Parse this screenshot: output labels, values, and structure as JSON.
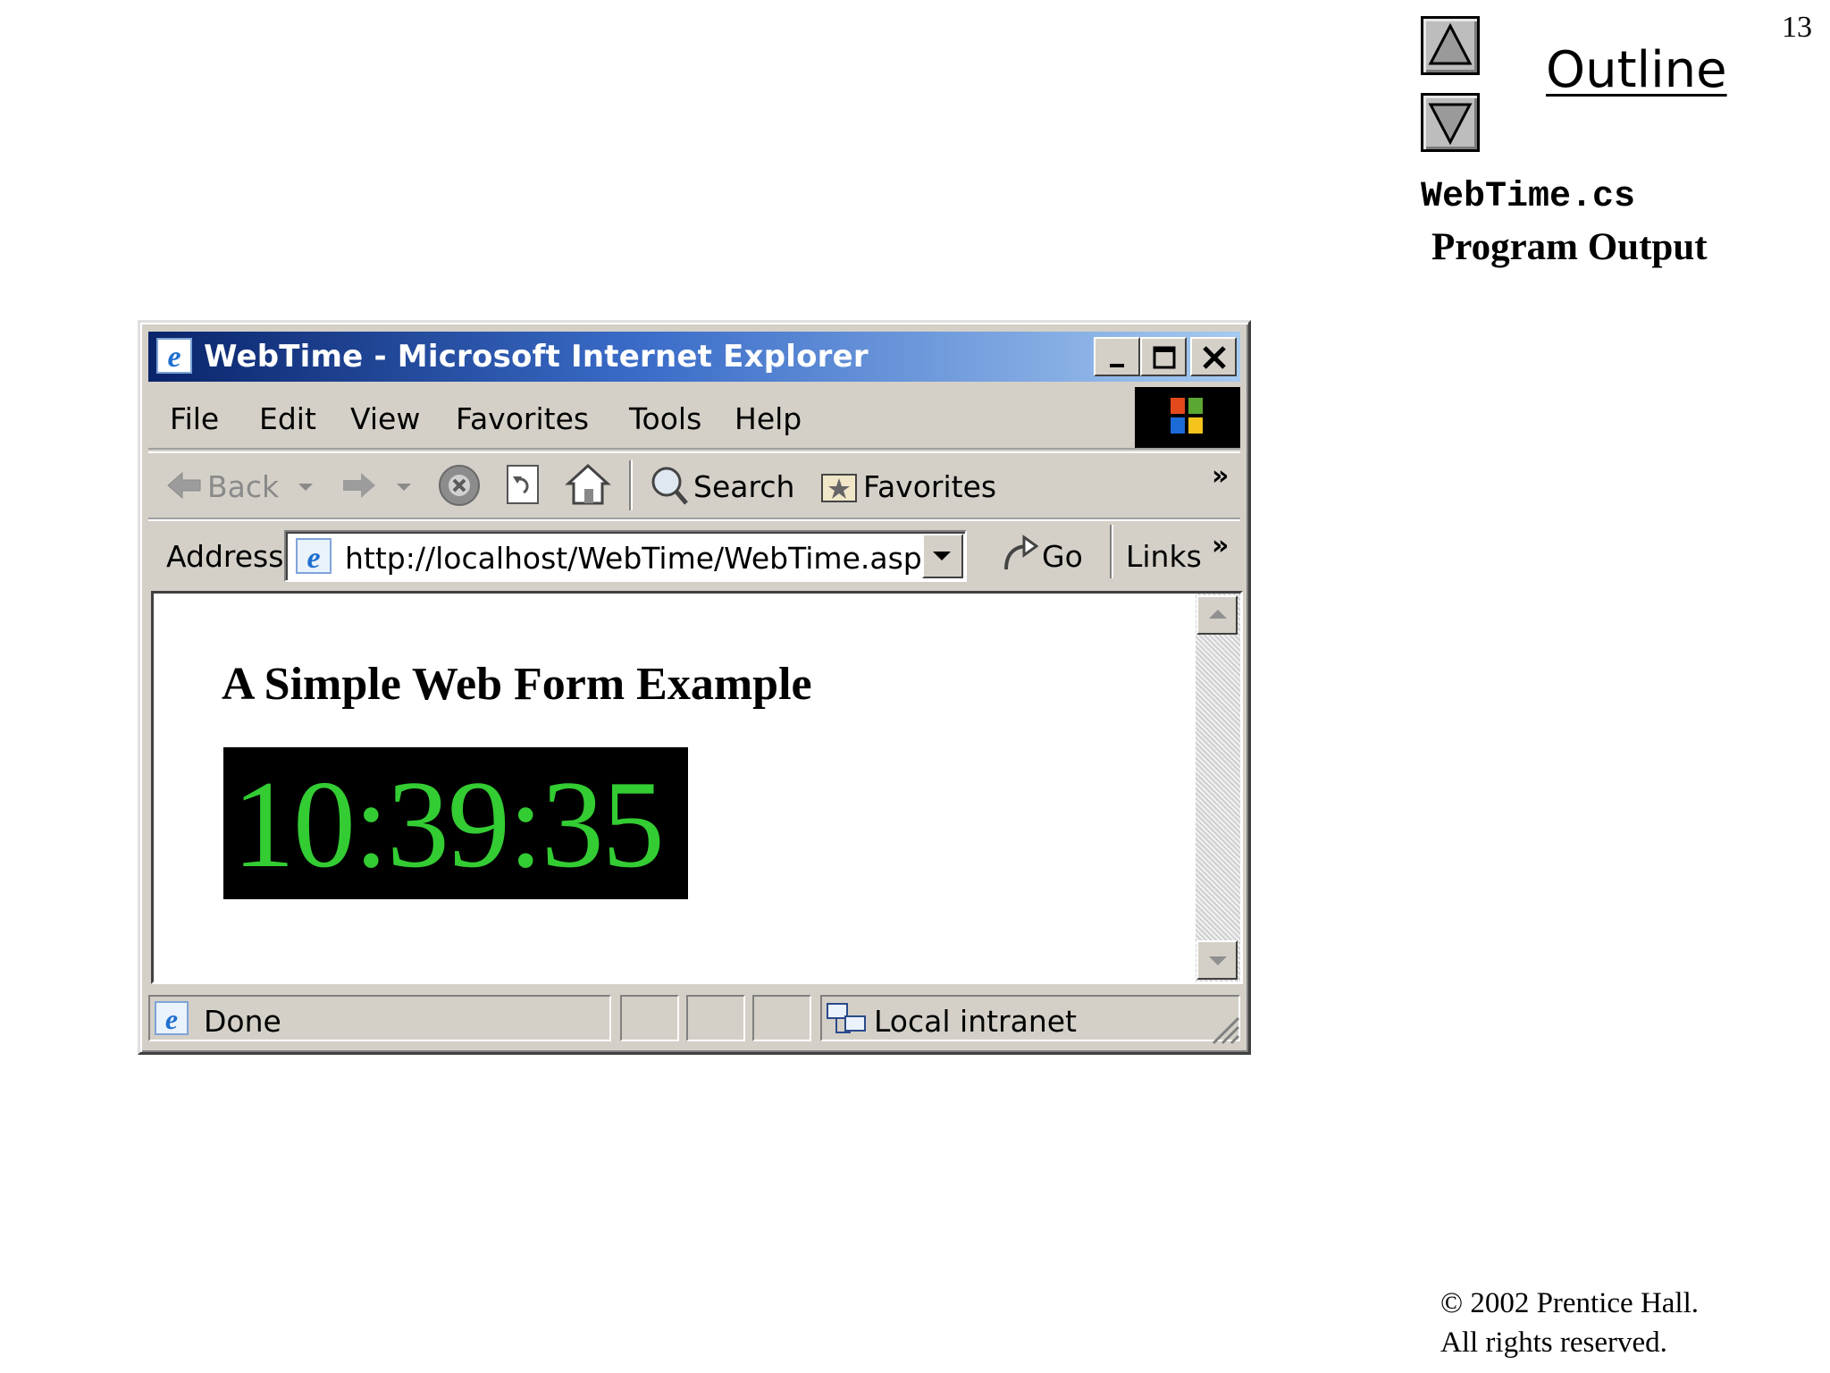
{
  "slide": {
    "number": "13",
    "outline_label": "Outline",
    "file_name": "WebTime.cs",
    "subtitle": "Program Output",
    "copyright_line1": "© 2002 Prentice Hall.",
    "copyright_line2": "All rights reserved."
  },
  "browser": {
    "title": "WebTime - Microsoft Internet Explorer",
    "menu": [
      "File",
      "Edit",
      "View",
      "Favorites",
      "Tools",
      "Help"
    ],
    "toolbar": {
      "back_label": "Back",
      "search_label": "Search",
      "favorites_label": "Favorites",
      "more": "»"
    },
    "address": {
      "label": "Address",
      "url": "http://localhost/WebTime/WebTime.aspx",
      "go_label": "Go",
      "links_label": "Links",
      "more": "»"
    },
    "page": {
      "heading": "A Simple Web Form Example",
      "time": "10:39:35",
      "time_color": "#33cc33"
    },
    "status": {
      "text": "Done",
      "zone": "Local intranet"
    }
  },
  "colors": {
    "titlebar_start": "#0a246a",
    "titlebar_end": "#a6caf0",
    "chrome": "#d4d0c8"
  }
}
